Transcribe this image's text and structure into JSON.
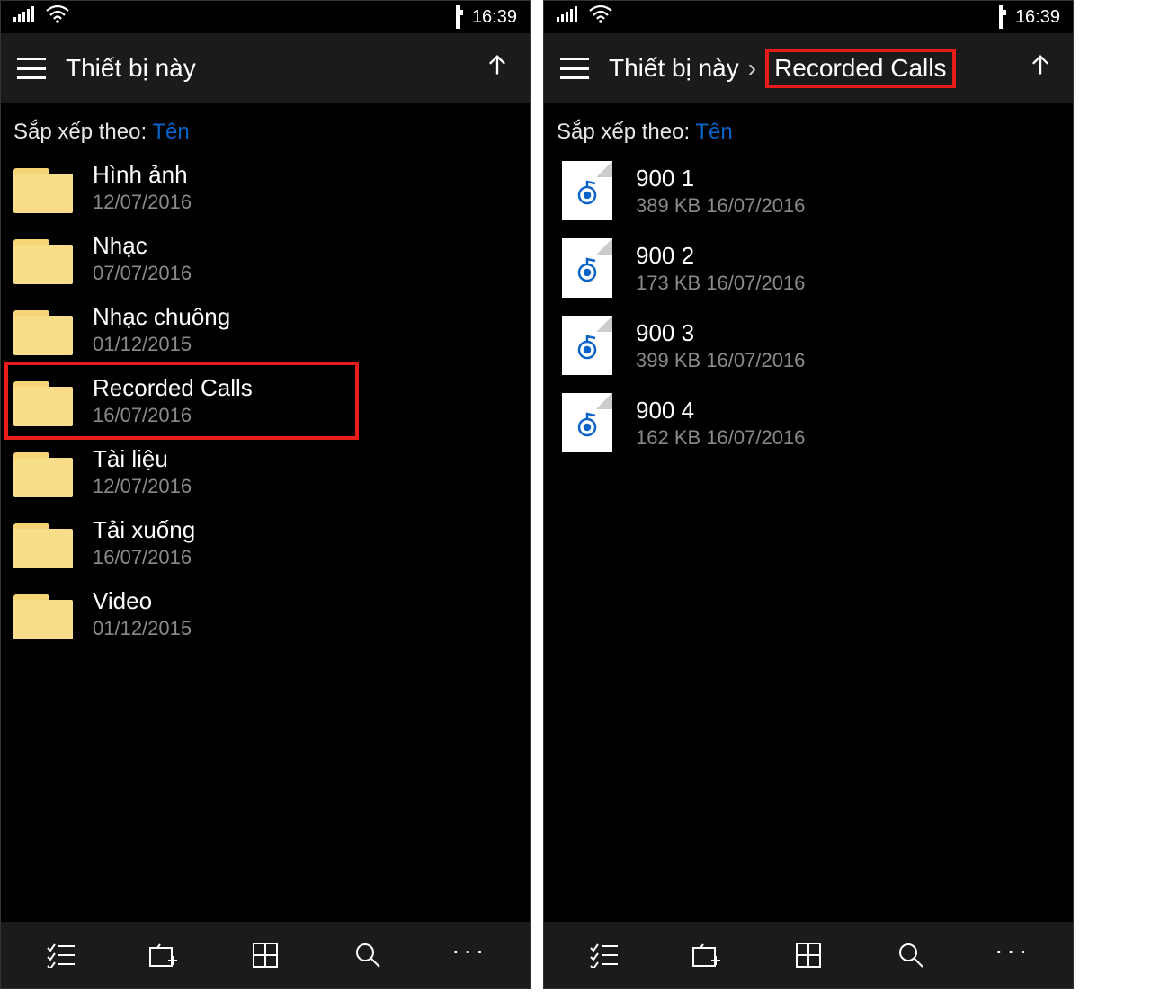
{
  "status": {
    "time": "16:39"
  },
  "left": {
    "title": "Thiết bị này",
    "sort_label": "Sắp xếp theo:",
    "sort_value": "Tên",
    "items": [
      {
        "name": "Hình ảnh",
        "date": "12/07/2016"
      },
      {
        "name": "Nhạc",
        "date": "07/07/2016"
      },
      {
        "name": "Nhạc chuông",
        "date": "01/12/2015"
      },
      {
        "name": "Recorded Calls",
        "date": "16/07/2016"
      },
      {
        "name": "Tài liệu",
        "date": "12/07/2016"
      },
      {
        "name": "Tải xuống",
        "date": "16/07/2016"
      },
      {
        "name": "Video",
        "date": "01/12/2015"
      }
    ],
    "highlight_index": 3
  },
  "right": {
    "breadcrumb_root": "Thiết bị này",
    "breadcrumb_current": "Recorded Calls",
    "sort_label": "Sắp xếp theo:",
    "sort_value": "Tên",
    "files": [
      {
        "name": "900 1",
        "size": "389 KB",
        "date": "16/07/2016"
      },
      {
        "name": "900 2",
        "size": "173 KB",
        "date": "16/07/2016"
      },
      {
        "name": "900 3",
        "size": "399 KB",
        "date": "16/07/2016"
      },
      {
        "name": "900 4",
        "size": "162 KB",
        "date": "16/07/2016"
      }
    ]
  }
}
